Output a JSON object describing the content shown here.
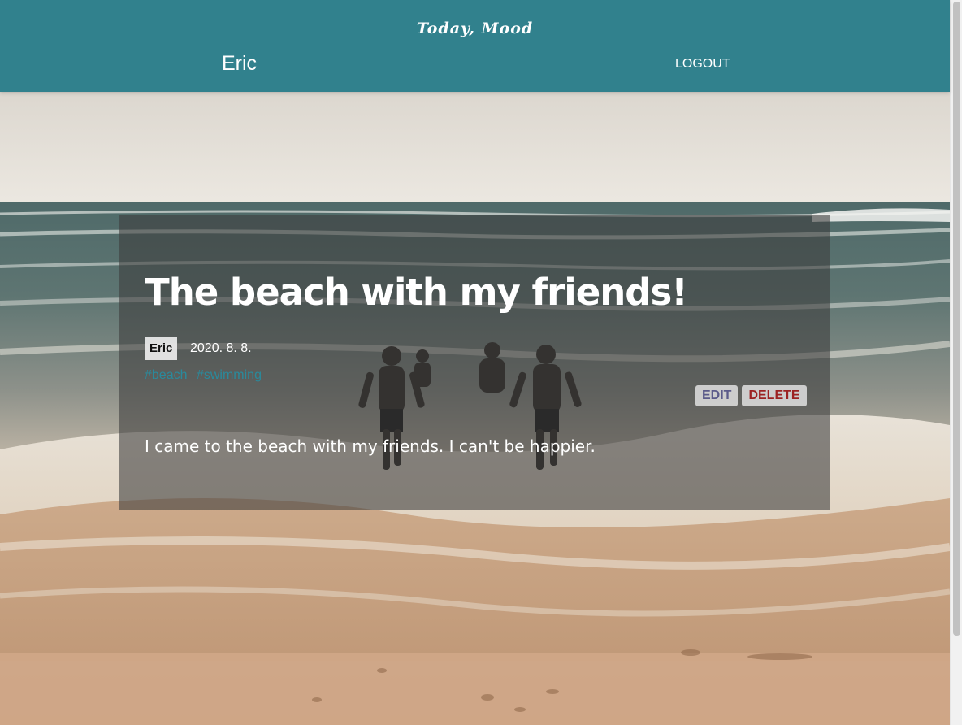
{
  "header": {
    "logo": "Today, Mood",
    "username": "Eric",
    "logout_label": "LOGOUT"
  },
  "post": {
    "title": "The beach with my friends!",
    "author": "Eric",
    "date": "2020. 8. 8.",
    "tags": [
      "#beach",
      "#swimming"
    ],
    "edit_label": "EDIT",
    "delete_label": "DELETE",
    "body": "I came to the beach with my friends. I can't be happier."
  },
  "colors": {
    "header_bg": "#31818d",
    "tag": "#2a8a9c",
    "edit": "#5b5b8a",
    "delete": "#9c2222"
  }
}
